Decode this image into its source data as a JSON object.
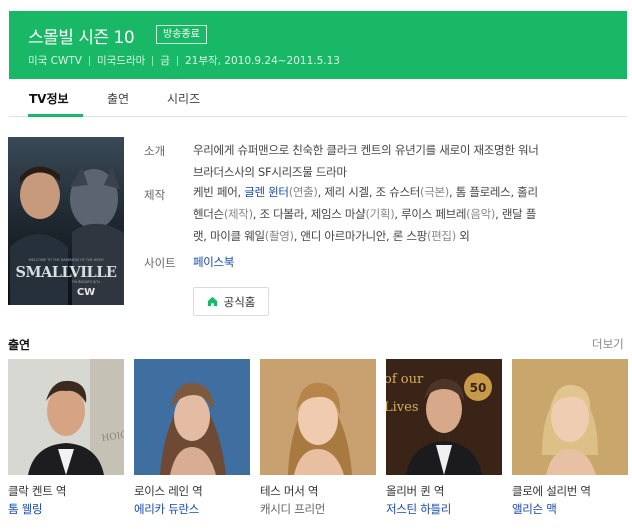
{
  "header": {
    "title": "스몰빌 시즌 10",
    "badge": "방송종료",
    "meta": [
      "미국 CWTV",
      "미국드라마",
      "금",
      "21부작, 2010.9.24~2011.5.13"
    ]
  },
  "tabs": [
    {
      "label": "TV정보",
      "active": true
    },
    {
      "label": "출연",
      "active": false
    },
    {
      "label": "시리즈",
      "active": false
    }
  ],
  "poster": {
    "title_text": "SMALLVILLE",
    "tagline": "WELCOME TO THE DARKNESS OF THE HERO",
    "network": "CW",
    "network_note": "THURSDAYS 8/7c"
  },
  "info": {
    "summary_label": "소개",
    "summary_line1": "우리에게 슈퍼맨으로 친숙한 클라크 켄트의 유년기를 새로이 재조명한 워너",
    "summary_line2": "브라더스사의 SF시리즈물 드라마",
    "production_label": "제작",
    "production": [
      {
        "name": "케빈 페어",
        "role": ""
      },
      {
        "name": "글렌 윈터",
        "role": "(연출)",
        "link": true
      },
      {
        "name": "제리 시겔",
        "role": ""
      },
      {
        "name": "조 슈스터",
        "role": "(극본)"
      },
      {
        "name": "톰 플로레스",
        "role": ""
      },
      {
        "name": "홀리",
        "role": ""
      }
    ],
    "production_line2": [
      {
        "name": "헨더슨",
        "role": "(제작)"
      },
      {
        "name": "조 다볼라",
        "role": ""
      },
      {
        "name": "제임스 마샬",
        "role": "(기획)"
      },
      {
        "name": "루이스 페브레",
        "role": "(음악)"
      },
      {
        "name": "랜달 플",
        "role": ""
      }
    ],
    "production_line3": [
      {
        "name": "랫",
        "role": ""
      },
      {
        "name": "마이클 웨일",
        "role": "(촬영)"
      },
      {
        "name": "앤디 아르마가니안",
        "role": ""
      },
      {
        "name": "론 스팡",
        "role": "(편집)"
      },
      {
        "name": "외",
        "role": ""
      }
    ],
    "site_label": "사이트",
    "site_value": "페이스북",
    "homepage_button": "공식홈"
  },
  "cast_section": {
    "title": "출연",
    "more": "더보기",
    "members": [
      {
        "role": "클락 켄트 역",
        "actor": "톰 웰링",
        "linked": true
      },
      {
        "role": "로이스 레인 역",
        "actor": "에리카 듀란스",
        "linked": true
      },
      {
        "role": "테스 머서 역",
        "actor": "캐시디 프리먼",
        "linked": false
      },
      {
        "role": "올리버 퀸 역",
        "actor": "저스틴 하틀리",
        "linked": true
      },
      {
        "role": "클로에 설리번 역",
        "actor": "앨리슨 맥",
        "linked": true
      }
    ]
  },
  "colors": {
    "brand_green": "#19b867",
    "link_blue": "#1a4aa8"
  }
}
